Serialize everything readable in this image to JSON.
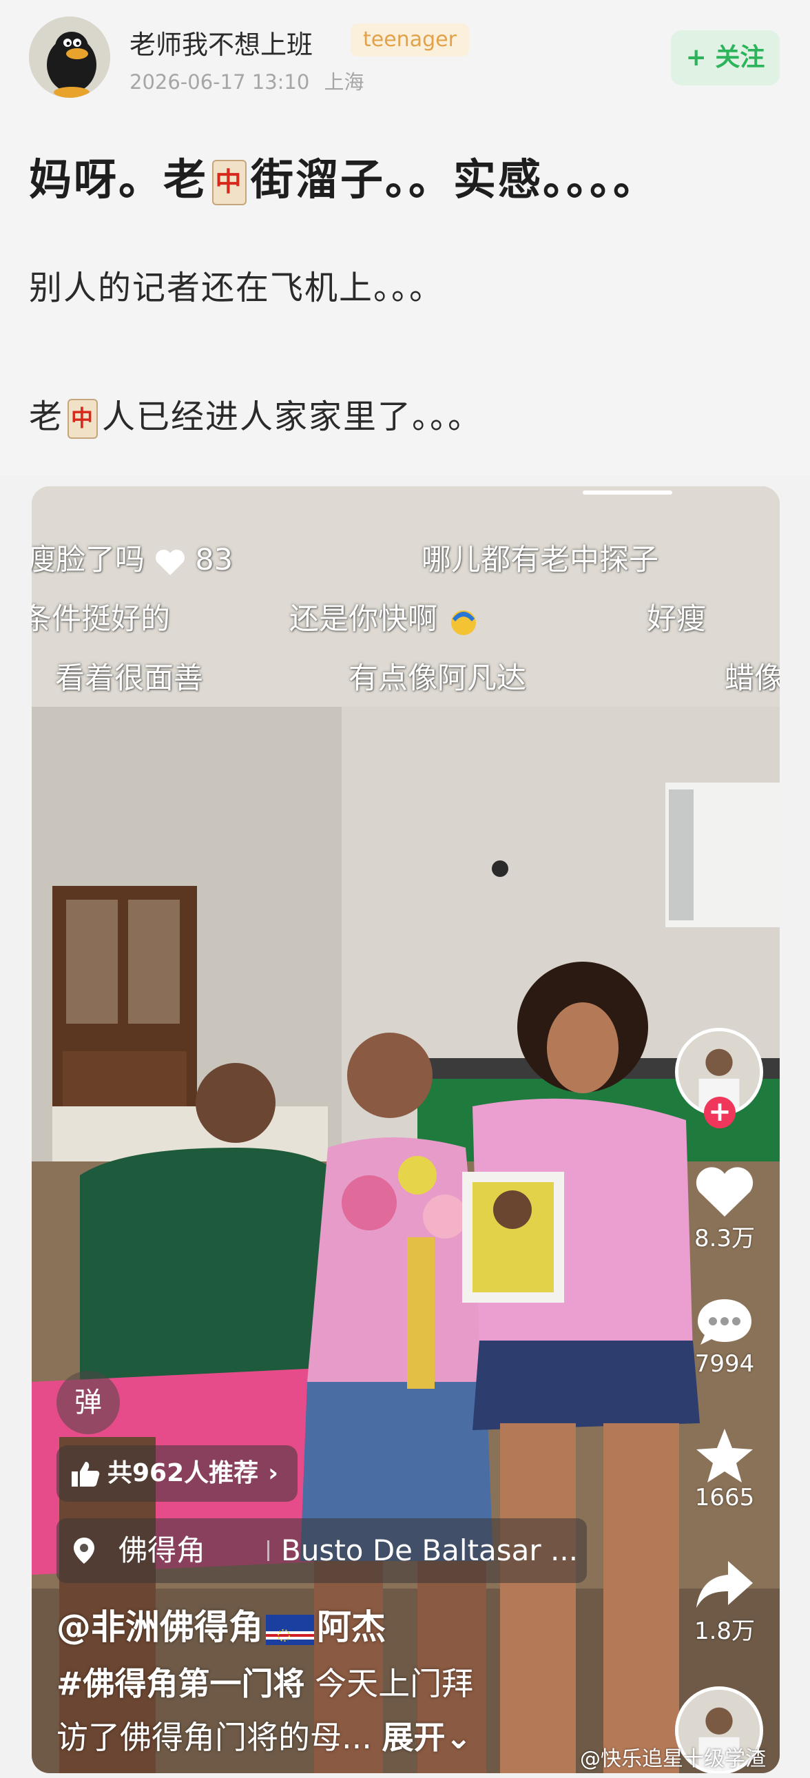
{
  "post": {
    "username": "老师我不想上班",
    "badge": "teenager",
    "date": "2026-06-17 13:10",
    "location": "上海",
    "follow_label": "+ 关注",
    "line1_before": "妈呀。老",
    "line1_tile": "中",
    "line1_after": "街溜子。。实感。。。。",
    "line2": "别人的记者还在飞机上。。。",
    "line3_before": "老",
    "line3_tile": "中",
    "line3_after": "人已经进人家家里了。。。"
  },
  "video": {
    "danmaku": [
      {
        "text": "瘦脸了吗"
      },
      {
        "text": "83"
      },
      {
        "text": "哪儿都有老中探子"
      },
      {
        "text": "条件挺好的"
      },
      {
        "text": "还是你快啊"
      },
      {
        "text": "好瘦"
      },
      {
        "text": "看着很面善"
      },
      {
        "text": "有点像阿凡达"
      },
      {
        "text": "蜡像"
      }
    ],
    "likes": "8.3万",
    "comments": "7994",
    "favorites": "1665",
    "shares": "1.8万",
    "danmaku_button": "弹",
    "recommend": "共962人推荐",
    "location_name": "佛得角",
    "location_place": "Busto De Baltasar ...",
    "author": "@非洲佛得角",
    "author_suffix": "阿杰",
    "hashtag": "#佛得角第一门将",
    "desc1_rest": " 今天上门拜",
    "desc2": "访了佛得角门将的母...",
    "expand": "展开",
    "watermark": "@快乐追星十级学渣"
  },
  "colors": {
    "follow_green": "#2db35b",
    "badge_orange": "#e2a24a",
    "plus_red": "#f0365a",
    "sofa_green": "#1f7a3e",
    "shirt_pink": "#e79bc8"
  }
}
